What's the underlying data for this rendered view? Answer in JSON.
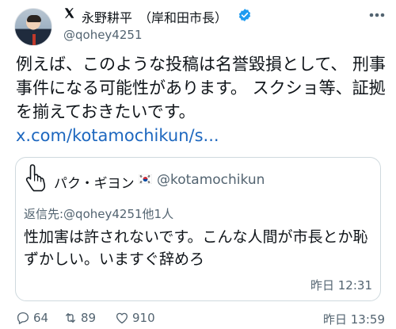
{
  "author": {
    "name": "永野耕平　（岸和田市長）",
    "handle": "@qohey4251",
    "verified": true,
    "avatar_icon": "profile-photo"
  },
  "post": {
    "text": "例えば、このような投稿は名誉毀損として、 刑事事件になる可能性があります。 スクショ等、証拠を揃えておきたいです。",
    "link": "x.com/kotamochikun/s..."
  },
  "quoted_post": {
    "name": "パク・ギヨン",
    "handle": "@kotamochikun",
    "reply_to": "返信先:@qohey4251他1人",
    "text": "性加害は許されないです。こんな人間が市長とか恥ずかしい。いますぐ辞めろ",
    "time": "昨日 12:31"
  },
  "stats": {
    "replies": "64",
    "reposts": "89",
    "likes": "910",
    "time": "昨日 13:59"
  },
  "colors": {
    "text": "#0f1419",
    "secondary": "#536471",
    "link": "#1d67bf",
    "verified": "#1d9bf0",
    "border": "#cfd9de"
  }
}
